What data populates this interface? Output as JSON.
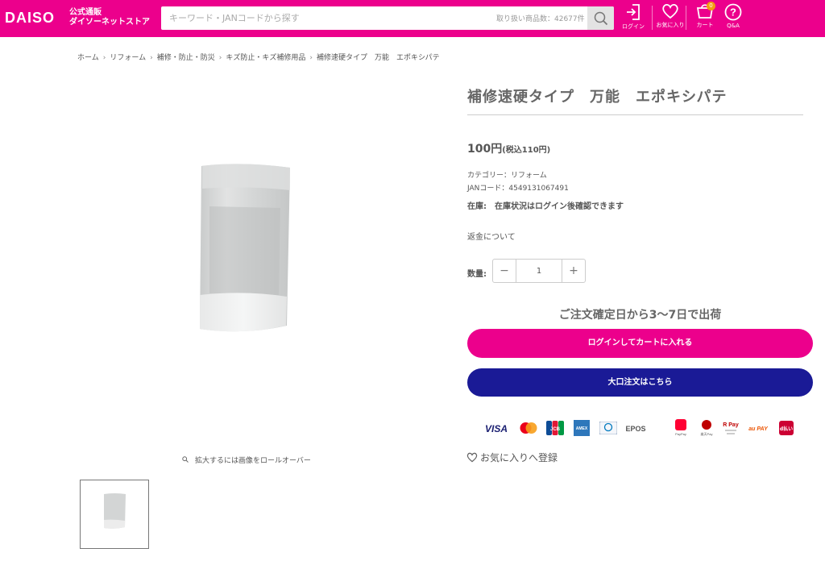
{
  "header": {
    "logo": "DAISO",
    "logo_sub_line1": "公式通販",
    "logo_sub_line2": "ダイソーネットストア",
    "search_placeholder": "キーワード・JANコードから探す",
    "search_count": "取り扱い商品数：42677件",
    "icons": {
      "login": "ログイン",
      "favorites": "お気に入り",
      "cart": "カート",
      "qa": "Q&A"
    },
    "cart_badge": "0",
    "brand_color": "#ec008c"
  },
  "breadcrumb": [
    "ホーム",
    "リフォーム",
    "補修・防止・防災",
    "キズ防止・キズ補修用品",
    "補修速硬タイプ　万能　エポキシパテ"
  ],
  "product": {
    "title": "補修速硬タイプ　万能　エポキシパテ",
    "price": "100円",
    "price_tax": "(税込110円)",
    "category": "カテゴリー：リフォーム",
    "jan": "JANコード：4549131067491",
    "stock": "在庫:　在庫状況はログイン後確認できます",
    "refund": "返金について",
    "qty_label": "数量:",
    "qty_minus": "−",
    "qty_value": "1",
    "qty_plus": "+",
    "shipping": "ご注文確定日から3〜7日で出荷",
    "cart_button": "ログインしてカートに入れる",
    "bulk_button": "大口注文はこちら",
    "favorite": "お気に入りへ登録",
    "zoom_hint": "拡大するには画像をロールオーバー"
  },
  "payments": [
    "VISA",
    "mastercard",
    "JCB",
    "AMEX",
    "Diners Club",
    "EPOS",
    "PayPay",
    "楽天Pay",
    "R Pay",
    "au PAY",
    "d払い"
  ],
  "colors": {
    "cart_button": "#ec008c",
    "bulk_button": "#1a1a96"
  }
}
